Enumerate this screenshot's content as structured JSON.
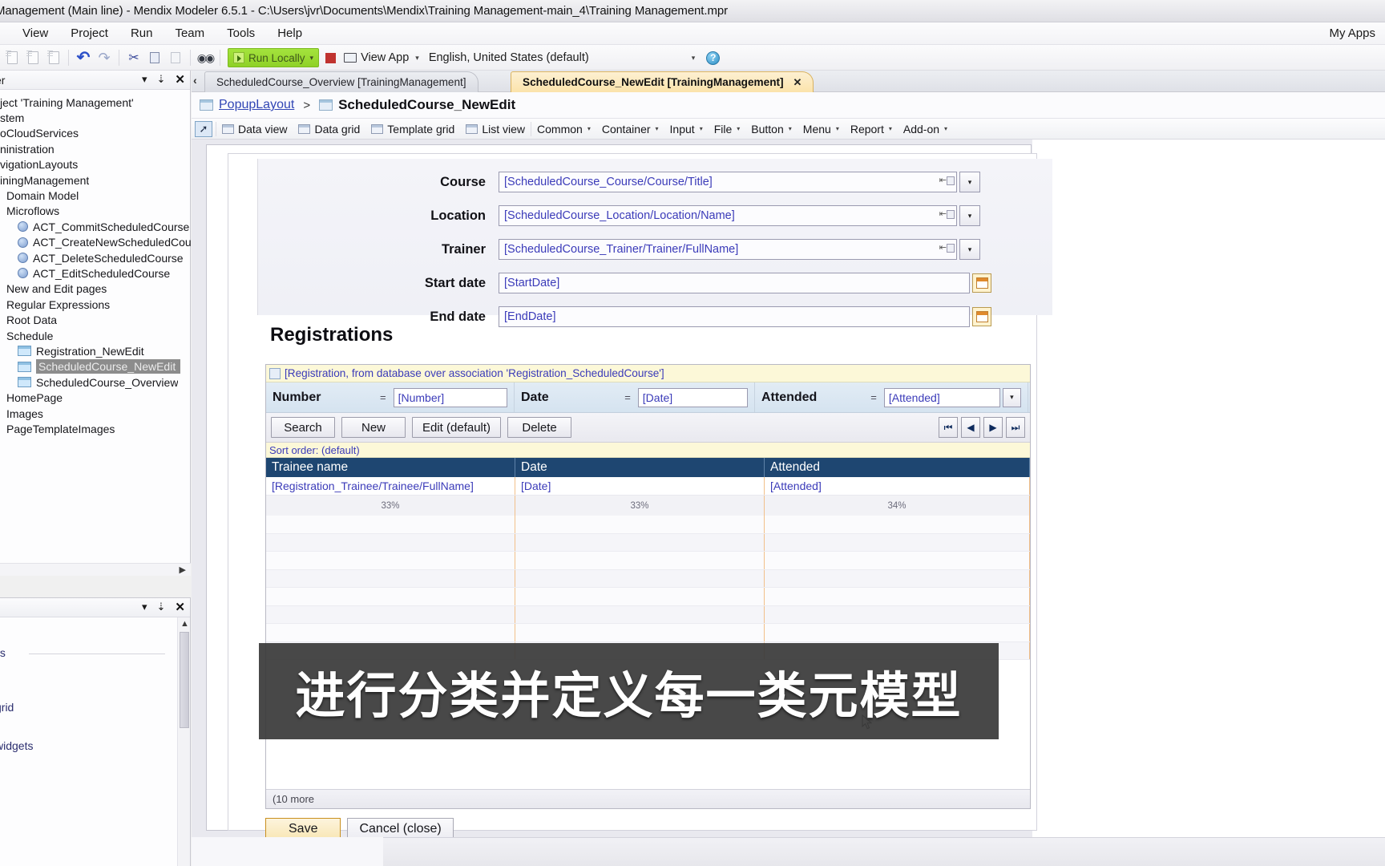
{
  "window": {
    "title": "Management (Main line) - Mendix Modeler 6.5.1 - C:\\Users\\jvr\\Documents\\Mendix\\Training Management-main_4\\Training Management.mpr"
  },
  "menu": {
    "items": [
      {
        "label": "View"
      },
      {
        "label": "Project"
      },
      {
        "label": "Run"
      },
      {
        "label": "Team"
      },
      {
        "label": "Tools"
      },
      {
        "label": "Help"
      }
    ],
    "my_apps": "My Apps"
  },
  "toolbar": {
    "new_icon": "new-document-icon",
    "open_icon": "open-document-icon",
    "save_icon": "save-document-icon",
    "undo_icon": "undo-icon",
    "redo_icon": "redo-icon",
    "cut_icon": "scissors-icon",
    "copy_icon": "copy-icon",
    "paste_icon": "paste-icon",
    "find_icon": "binoculars-icon",
    "run_locally": "Run Locally",
    "run_caret": "▾",
    "stop_icon": "stop-square-icon",
    "view_app": "View App",
    "view_app_caret": "▾",
    "locale": "English, United States (default)",
    "locale_caret": "▾",
    "help_icon": "help-question-icon",
    "help_glyph": "?"
  },
  "left_dock": {
    "title": "er",
    "dropdown_glyph": "▾",
    "pin_glyph": "⇣",
    "close_glyph": "✕",
    "scroll_right_glyph": "▶",
    "tree": [
      {
        "label": "ject 'Training Management'",
        "indent": 0,
        "icon": "none"
      },
      {
        "label": "stem",
        "indent": 0,
        "icon": "none"
      },
      {
        "label": "oCloudServices",
        "indent": 0,
        "icon": "none"
      },
      {
        "label": "ninistration",
        "indent": 0,
        "icon": "none"
      },
      {
        "label": "vigationLayouts",
        "indent": 0,
        "icon": "none"
      },
      {
        "label": "iningManagement",
        "indent": 0,
        "icon": "none"
      },
      {
        "label": "Domain Model",
        "indent": 1,
        "icon": "none"
      },
      {
        "label": "Microflows",
        "indent": 1,
        "icon": "none"
      },
      {
        "label": "ACT_CommitScheduledCourse",
        "indent": 2,
        "icon": "microflow"
      },
      {
        "label": "ACT_CreateNewScheduledCourse",
        "indent": 2,
        "icon": "microflow"
      },
      {
        "label": "ACT_DeleteScheduledCourse",
        "indent": 2,
        "icon": "microflow"
      },
      {
        "label": "ACT_EditScheduledCourse",
        "indent": 2,
        "icon": "microflow"
      },
      {
        "label": "New and Edit pages",
        "indent": 1,
        "icon": "none"
      },
      {
        "label": "Regular Expressions",
        "indent": 1,
        "icon": "none"
      },
      {
        "label": "Root Data",
        "indent": 1,
        "icon": "none"
      },
      {
        "label": "Schedule",
        "indent": 1,
        "icon": "none"
      },
      {
        "label": "Registration_NewEdit",
        "indent": 2,
        "icon": "page"
      },
      {
        "label": "ScheduledCourse_NewEdit",
        "indent": 2,
        "icon": "page",
        "selected": true
      },
      {
        "label": "ScheduledCourse_Overview",
        "indent": 2,
        "icon": "page"
      },
      {
        "label": "HomePage",
        "indent": 1,
        "icon": "none"
      },
      {
        "label": "Images",
        "indent": 1,
        "icon": "none"
      },
      {
        "label": "PageTemplateImages",
        "indent": 1,
        "icon": "none"
      }
    ]
  },
  "left_dock_bottom": {
    "dropdown_glyph": "▾",
    "pin_glyph": "⇣",
    "close_glyph": "✕",
    "scroll_up_glyph": "▲",
    "groups": [
      {
        "label": "ts"
      },
      {
        "label": "grid"
      },
      {
        "label": "widgets"
      }
    ]
  },
  "editor": {
    "tab_nav_glyph": "‹",
    "tabs": [
      {
        "label": "ScheduledCourse_Overview [TrainingManagement]",
        "active": false
      },
      {
        "label": "ScheduledCourse_NewEdit [TrainingManagement]",
        "active": true,
        "close_glyph": "✕"
      }
    ],
    "breadcrumb": {
      "parent": "PopupLayout",
      "separator": ">",
      "current": "ScheduledCourse_NewEdit",
      "parent_icon": "layout-icon",
      "current_icon": "page-icon"
    },
    "widget_bar": {
      "pointer_icon": "pointer-arrow-icon",
      "items": [
        {
          "label": "Data view",
          "icon": "data-view-icon",
          "caret": false
        },
        {
          "label": "Data grid",
          "icon": "data-grid-icon",
          "caret": false
        },
        {
          "label": "Template grid",
          "icon": "template-grid-icon",
          "caret": false
        },
        {
          "label": "List view",
          "icon": "list-view-icon",
          "caret": false
        },
        {
          "label": "Common",
          "icon": "none",
          "caret": true
        },
        {
          "label": "Container",
          "icon": "none",
          "caret": true
        },
        {
          "label": "Input",
          "icon": "none",
          "caret": true
        },
        {
          "label": "File",
          "icon": "none",
          "caret": true
        },
        {
          "label": "Button",
          "icon": "none",
          "caret": true
        },
        {
          "label": "Menu",
          "icon": "none",
          "caret": true
        },
        {
          "label": "Report",
          "icon": "none",
          "caret": true
        },
        {
          "label": "Add-on",
          "icon": "none",
          "caret": true
        }
      ]
    }
  },
  "form": {
    "rows": [
      {
        "label": "Course",
        "value": "[ScheduledCourse_Course/Course/Title]",
        "control": "reference-selector"
      },
      {
        "label": "Location",
        "value": "[ScheduledCourse_Location/Location/Name]",
        "control": "reference-selector"
      },
      {
        "label": "Trainer",
        "value": "[ScheduledCourse_Trainer/Trainer/FullName]",
        "control": "reference-selector"
      },
      {
        "label": "Start date",
        "value": "[StartDate]",
        "control": "date-picker"
      },
      {
        "label": "End date",
        "value": "[EndDate]",
        "control": "date-picker"
      }
    ],
    "dropdown_glyph": "▾",
    "reference_glyph": "⇤",
    "calendar_icon": "calendar-icon"
  },
  "registrations": {
    "heading": "Registrations",
    "datasource": "[Registration, from database over association 'Registration_ScheduledCourse']",
    "datasource_icon": "database-association-icon",
    "search_fields": [
      {
        "label": "Number",
        "operator": "=",
        "value": "[Number]",
        "has_dropdown": false
      },
      {
        "label": "Date",
        "operator": "=",
        "value": "[Date]",
        "has_dropdown": false
      },
      {
        "label": "Attended",
        "operator": "=",
        "value": "[Attended]",
        "has_dropdown": true
      }
    ],
    "buttons": [
      {
        "label": "Search"
      },
      {
        "label": "New"
      },
      {
        "label": "Edit (default)"
      },
      {
        "label": "Delete"
      }
    ],
    "pager": [
      {
        "glyph": "⏮",
        "name": "first-page-button"
      },
      {
        "glyph": "◀",
        "name": "previous-page-button"
      },
      {
        "glyph": "▶",
        "name": "next-page-button"
      },
      {
        "glyph": "⏭",
        "name": "last-page-button"
      }
    ],
    "sort_order": "Sort order: (default)",
    "columns": [
      {
        "header": "Trainee name",
        "cell": "[Registration_Trainee/Trainee/FullName]",
        "width_pct": "33%"
      },
      {
        "header": "Date",
        "cell": "[Date]",
        "width_pct": "33%"
      },
      {
        "header": "Attended",
        "cell": "[Attended]",
        "width_pct": "34%"
      }
    ],
    "footer": "(10 more"
  },
  "actions": {
    "save": "Save",
    "cancel": "Cancel (close)"
  },
  "overlay": {
    "subtitle": "进行分类并定义每一类元模型"
  },
  "cursor": {
    "icon": "mouse-pointer-icon"
  },
  "colors": {
    "accent_green": "#8fd128",
    "tab_active": "#fbe3ab",
    "grid_header": "#1e4671",
    "expression_blue": "#3b3bb9",
    "datasource_yellow": "#fcf8d8",
    "stop_red": "#c0332f",
    "link_blue": "#3146b5"
  }
}
